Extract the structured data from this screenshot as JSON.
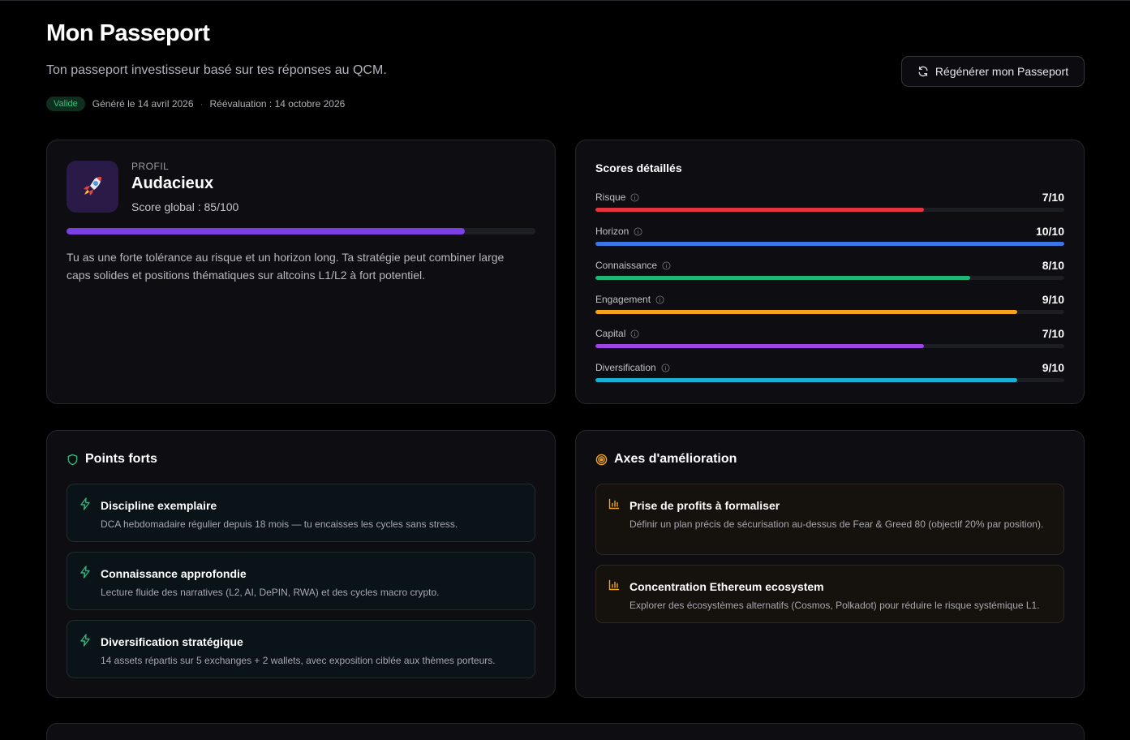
{
  "header": {
    "title": "Mon Passeport",
    "subtitle": "Ton passeport investisseur basé sur tes réponses au QCM.",
    "regen_label": "Régénérer mon Passeport",
    "status_badge": "Valide",
    "generated": "Généré le 14 avril 2026",
    "separator": "·",
    "reevaluation": "Réévaluation : 14 octobre 2026"
  },
  "profile": {
    "label": "PROFIL",
    "name": "Audacieux",
    "score_text": "Score global : 85/100",
    "score_value": 85,
    "score_max": 100,
    "bar_color": "#7b3fe4",
    "icon": "rocket-icon",
    "description": "Tu as une forte tolérance au risque et un horizon long. Ta stratégie peut combiner large caps solides et positions thématiques sur altcoins L1/L2 à fort potentiel."
  },
  "scores": {
    "title": "Scores détaillés",
    "items": [
      {
        "label": "Risque",
        "value_text": "7/10",
        "value": 7,
        "max": 10,
        "color": "#e5333d"
      },
      {
        "label": "Horizon",
        "value_text": "10/10",
        "value": 10,
        "max": 10,
        "color": "#3b78e7"
      },
      {
        "label": "Connaissance",
        "value_text": "8/10",
        "value": 8,
        "max": 10,
        "color": "#1fb577"
      },
      {
        "label": "Engagement",
        "value_text": "9/10",
        "value": 9,
        "max": 10,
        "color": "#f5a31a"
      },
      {
        "label": "Capital",
        "value_text": "7/10",
        "value": 7,
        "max": 10,
        "color": "#9b45e4"
      },
      {
        "label": "Diversification",
        "value_text": "9/10",
        "value": 9,
        "max": 10,
        "color": "#17b0d6"
      }
    ]
  },
  "strengths": {
    "title": "Points forts",
    "icon": "shield-icon",
    "items": [
      {
        "title": "Discipline exemplaire",
        "desc": "DCA hebdomadaire régulier depuis 18 mois — tu encaisses les cycles sans stress."
      },
      {
        "title": "Connaissance approfondie",
        "desc": "Lecture fluide des narratives (L2, AI, DePIN, RWA) et des cycles macro crypto."
      },
      {
        "title": "Diversification stratégique",
        "desc": "14 assets répartis sur 5 exchanges + 2 wallets, avec exposition ciblée aux thèmes porteurs."
      }
    ]
  },
  "improvements": {
    "title": "Axes d'amélioration",
    "icon": "target-icon",
    "items": [
      {
        "title": "Prise de profits à formaliser",
        "desc": "Définir un plan précis de sécurisation au-dessus de Fear & Greed 80 (objectif 20% par position)."
      },
      {
        "title": "Concentration Ethereum ecosystem",
        "desc": "Explorer des écosystèmes alternatifs (Cosmos, Polkadot) pour réduire le risque systémique L1."
      }
    ]
  },
  "colors": {
    "accent_purple": "#7b3fe4",
    "strength_green": "#2fb47c",
    "improve_amber": "#f5a31a",
    "badge_green": "#35c27a"
  }
}
